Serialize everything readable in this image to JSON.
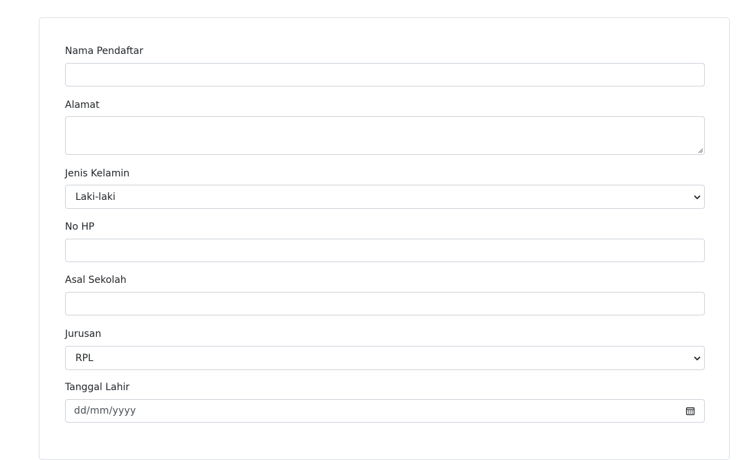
{
  "form": {
    "nama": {
      "label": "Nama Pendaftar",
      "value": ""
    },
    "alamat": {
      "label": "Alamat",
      "value": ""
    },
    "jenis_kelamin": {
      "label": "Jenis Kelamin",
      "selected": "Laki-laki"
    },
    "no_hp": {
      "label": "No HP",
      "value": ""
    },
    "asal_sekolah": {
      "label": "Asal Sekolah",
      "value": ""
    },
    "jurusan": {
      "label": "Jurusan",
      "selected": "RPL"
    },
    "tanggal_lahir": {
      "label": "Tanggal Lahir",
      "placeholder": "dd/mm/yyyy"
    }
  },
  "icons": {
    "select": "chevron-down-icon",
    "date": "calendar-icon"
  },
  "colors": {
    "border": "#ced4da",
    "text": "#212529",
    "card_border": "#dcdfe3"
  }
}
